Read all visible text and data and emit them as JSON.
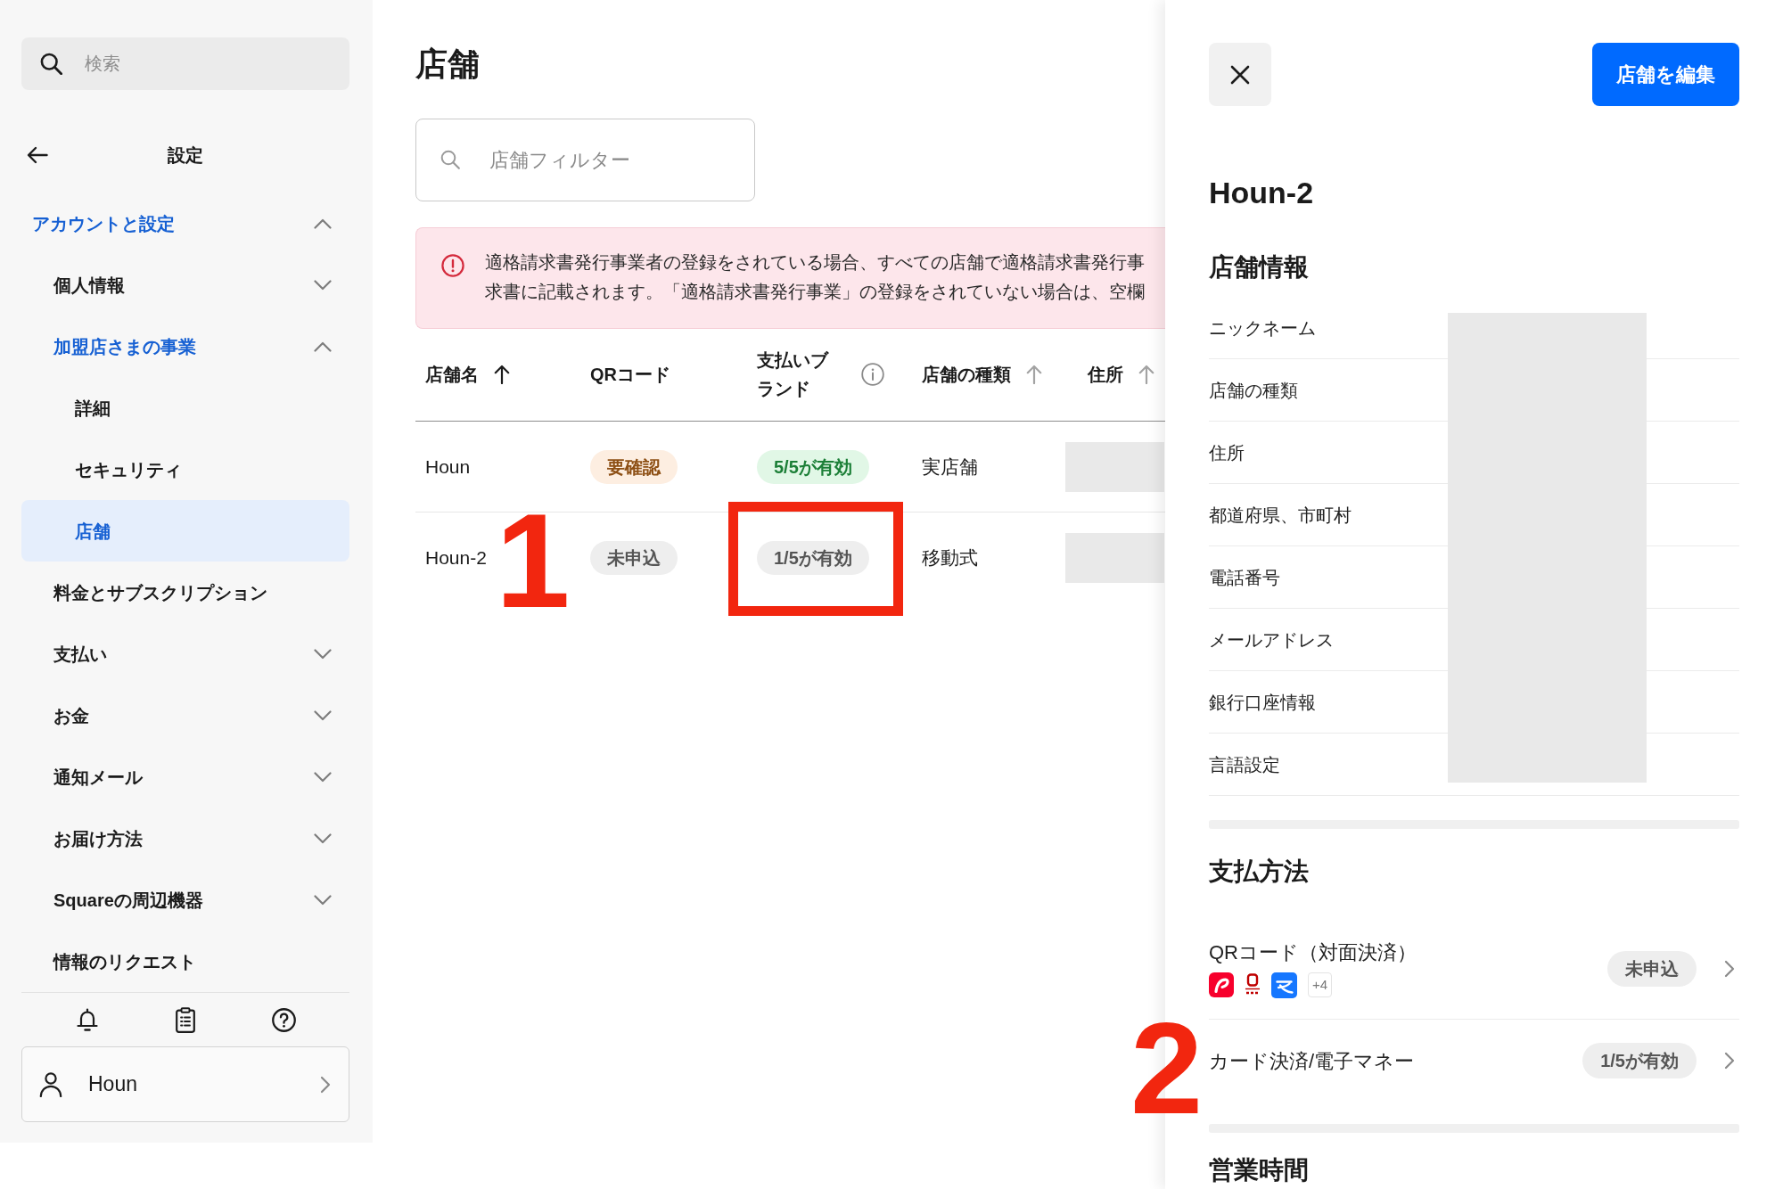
{
  "sidebar": {
    "search": {
      "placeholder": "検索"
    },
    "header": {
      "title": "設定"
    },
    "nav": [
      {
        "label": "アカウントと設定",
        "expanded": true,
        "selected": false,
        "children": [
          {
            "label": "個人情報",
            "expanded": false,
            "selected": false
          },
          {
            "label": "加盟店さまの事業",
            "expanded": true,
            "selected": false,
            "children": [
              {
                "label": "詳細",
                "selected": false
              },
              {
                "label": "セキュリティ",
                "selected": false
              },
              {
                "label": "店舗",
                "selected": true
              }
            ]
          },
          {
            "label": "料金とサブスクリプション",
            "selected": false
          },
          {
            "label": "支払い",
            "expanded": false,
            "selected": false
          },
          {
            "label": "お金",
            "expanded": false,
            "selected": false
          },
          {
            "label": "通知メール",
            "expanded": false,
            "selected": false
          },
          {
            "label": "お届け方法",
            "expanded": false,
            "selected": false
          },
          {
            "label": "Squareの周辺機器",
            "expanded": false,
            "selected": false
          },
          {
            "label": "情報のリクエスト",
            "selected": false
          }
        ]
      }
    ],
    "account": {
      "name": "Houn"
    }
  },
  "main": {
    "title": "店舗",
    "filter": {
      "placeholder": "店舗フィルター"
    },
    "alert": {
      "kind": "error",
      "lines": [
        "適格請求書発行事業者の登録をされている場合、すべての店舗で適格請求書発行事",
        "求書に記載されます。「適格請求書発行事業」の登録をされていない場合は、空欄"
      ]
    },
    "table": {
      "columns": [
        {
          "label": "店舗名",
          "kind": "sort",
          "sorted": true
        },
        {
          "label": "QRコード",
          "kind": "plain",
          "sorted": false
        },
        {
          "label": "支払いブランド",
          "kind": "info",
          "sorted": false
        },
        {
          "label": "店舗の種類",
          "kind": "sort",
          "sorted": false
        },
        {
          "label": "住所",
          "kind": "sort",
          "sorted": false
        }
      ],
      "rows": [
        {
          "name": "Houn",
          "qr_status": {
            "text": "要確認",
            "kind": "warning"
          },
          "brands": {
            "text": "5/5が有効",
            "kind": "success"
          },
          "store_type": "実店舗",
          "address_redacted": true,
          "highlighted": false
        },
        {
          "name": "Houn-2",
          "annotation": "1",
          "qr_status": {
            "text": "未申込",
            "kind": "neutral"
          },
          "brands": {
            "text": "1/5が有効",
            "kind": "neutral"
          },
          "store_type": "移動式",
          "address_redacted": true,
          "highlighted": true
        }
      ]
    }
  },
  "panel": {
    "edit_button": "店舗を編集",
    "title": "Houn-2",
    "info_section": {
      "heading": "店舗情報",
      "fields": [
        "ニックネーム",
        "店舗の種類",
        "住所",
        "都道府県、市町村",
        "電話番号",
        "メールアドレス",
        "銀行口座情報",
        "言語設定"
      ],
      "values_redacted": true
    },
    "payment_section": {
      "heading": "支払方法",
      "methods": [
        {
          "kind": "qr",
          "label": "QRコード（対面決済）",
          "more_logos": "+4",
          "status": {
            "text": "未申込",
            "kind": "neutral"
          }
        },
        {
          "kind": "card",
          "label": "カード決済/電子マネー",
          "annotation": "2",
          "status": {
            "text": "1/5が有効",
            "kind": "neutral"
          }
        }
      ]
    },
    "hours_section": {
      "heading": "営業時間"
    }
  }
}
